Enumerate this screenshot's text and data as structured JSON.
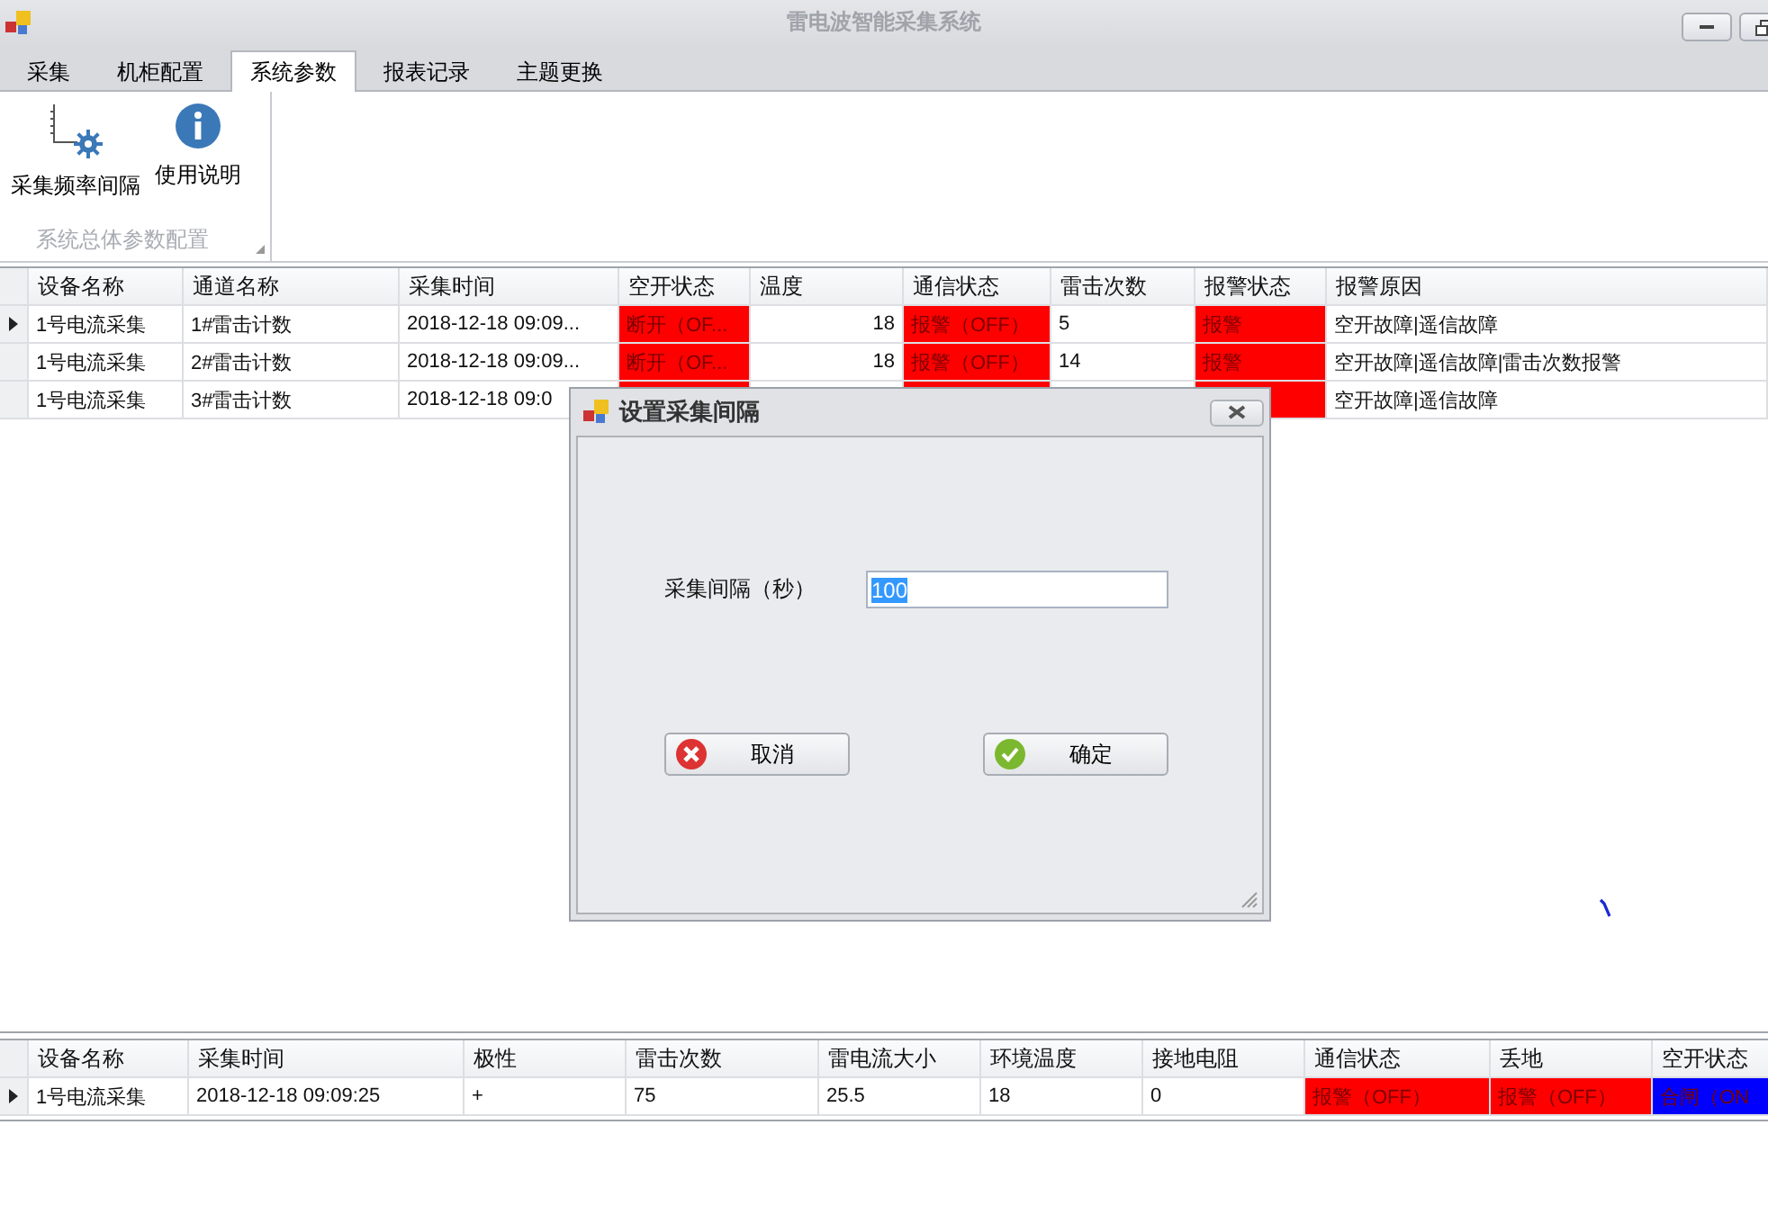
{
  "window": {
    "title": "雷电波智能采集系统"
  },
  "tabs": [
    {
      "label": "采集",
      "selected": false
    },
    {
      "label": "机柜配置",
      "selected": false
    },
    {
      "label": "系统参数",
      "selected": true
    },
    {
      "label": "报表记录",
      "selected": false
    },
    {
      "label": "主题更换",
      "selected": false
    }
  ],
  "ribbon": {
    "buttons": [
      {
        "label": "采集频率间隔",
        "kind": "gear"
      },
      {
        "label": "使用说明",
        "kind": "info"
      }
    ],
    "group_label": "系统总体参数配置"
  },
  "top_grid": {
    "columns": [
      "设备名称",
      "通道名称",
      "采集时间",
      "空开状态",
      "温度",
      "通信状态",
      "雷击次数",
      "报警状态",
      "报警原因"
    ],
    "rows": [
      {
        "selected": true,
        "cells": [
          {
            "text": "1号电流采集"
          },
          {
            "text": "1#雷击计数"
          },
          {
            "text": "2018-12-18 09:09..."
          },
          {
            "text": "断开（OF...",
            "color": "#ff0000"
          },
          {
            "text": "18"
          },
          {
            "text": "报警（OFF）",
            "color": "#ff0000"
          },
          {
            "text": "5"
          },
          {
            "text": "报警",
            "color": "#ff0000"
          },
          {
            "text": "空开故障|遥信故障"
          }
        ]
      },
      {
        "selected": false,
        "cells": [
          {
            "text": "1号电流采集"
          },
          {
            "text": "2#雷击计数"
          },
          {
            "text": "2018-12-18 09:09..."
          },
          {
            "text": "断开（OF...",
            "color": "#ff0000"
          },
          {
            "text": "18"
          },
          {
            "text": "报警（OFF）",
            "color": "#ff0000"
          },
          {
            "text": "14"
          },
          {
            "text": "报警",
            "color": "#ff0000"
          },
          {
            "text": "空开故障|遥信故障|雷击次数报警"
          }
        ]
      },
      {
        "selected": false,
        "cells": [
          {
            "text": "1号电流采集"
          },
          {
            "text": "3#雷击计数"
          },
          {
            "text": "2018-12-18 09:0"
          },
          {
            "color": "#ff0000"
          },
          {},
          {
            "color": "#ff0000"
          },
          {},
          {
            "color": "#ff0000"
          },
          {
            "text": "空开故障|遥信故障"
          }
        ]
      }
    ]
  },
  "bottom_grid": {
    "columns": [
      "设备名称",
      "采集时间",
      "极性",
      "雷击次数",
      "雷电流大小",
      "环境温度",
      "接地电阻",
      "通信状态",
      "丢地",
      "空开状态"
    ],
    "rows": [
      {
        "selected": true,
        "cells": [
          {
            "text": "1号电流采集"
          },
          {
            "text": "2018-12-18 09:09:25"
          },
          {
            "text": "+"
          },
          {
            "text": "75"
          },
          {
            "text": "25.5"
          },
          {
            "text": "18"
          },
          {
            "text": "0"
          },
          {
            "text": "报警（OFF）",
            "color": "#ff0000"
          },
          {
            "text": "报警（OFF）",
            "color": "#ff0000"
          },
          {
            "text": "合闸（ON",
            "color": "#0000ff"
          }
        ]
      }
    ]
  },
  "dialog": {
    "title": "设置采集间隔",
    "label": "采集间隔（秒）",
    "value": "100",
    "buttons": [
      {
        "label": "取消",
        "kind": "cancel"
      },
      {
        "label": "确定",
        "kind": "ok"
      }
    ]
  }
}
